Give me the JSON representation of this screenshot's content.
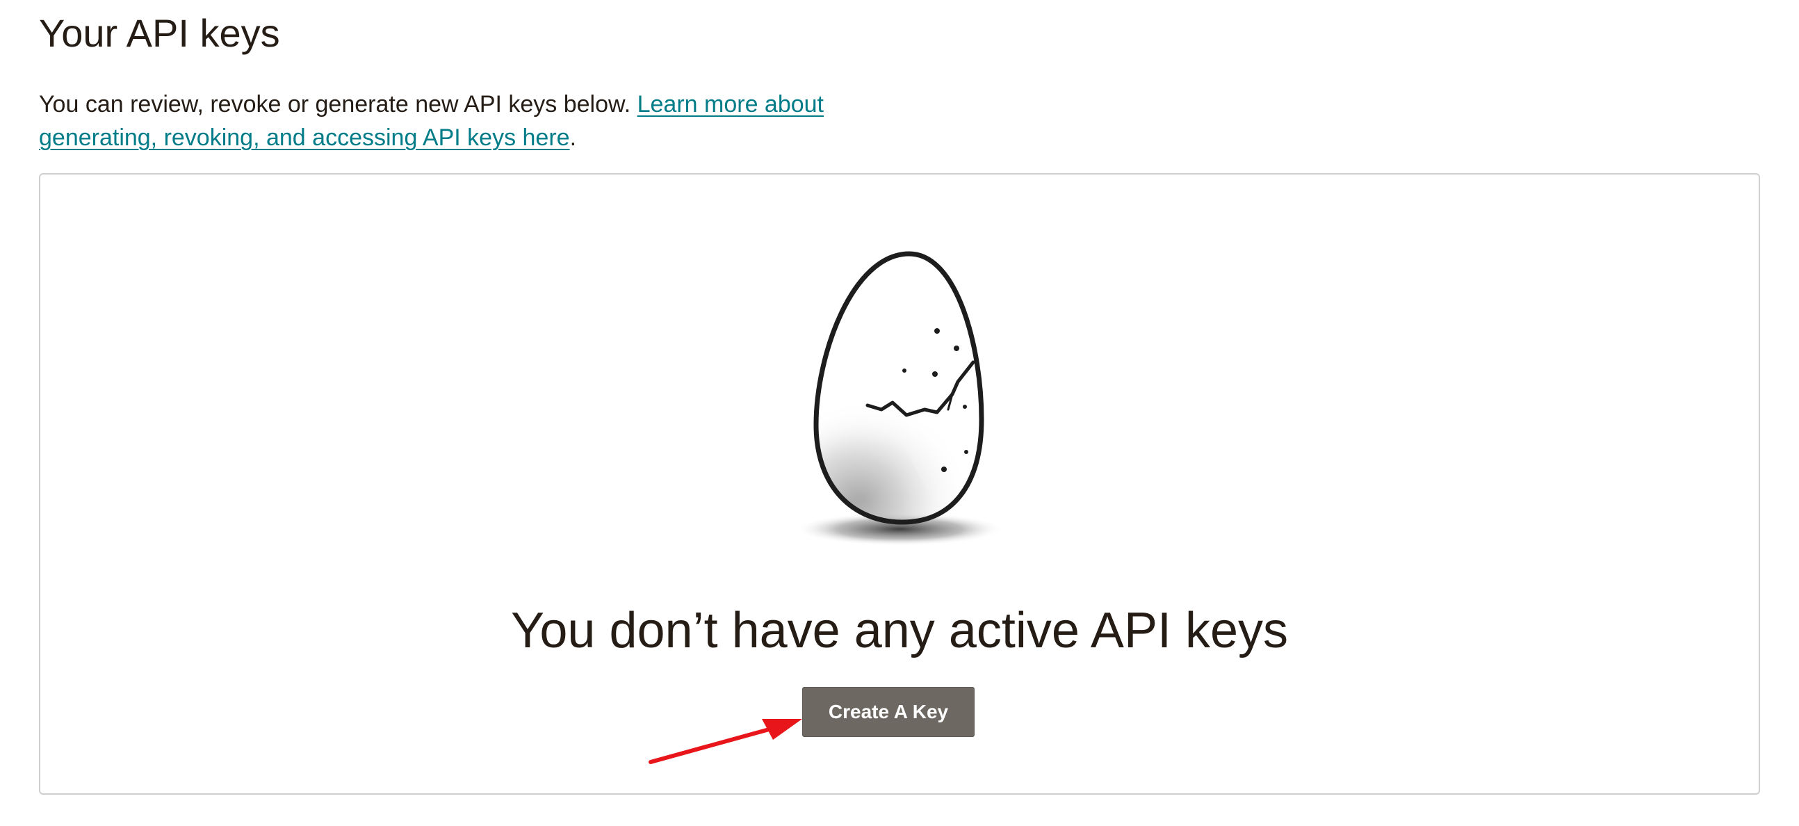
{
  "header": {
    "title": "Your API keys"
  },
  "intro": {
    "text": "You can review, revoke or generate new API keys below.",
    "link_text": "Learn more about generating, revoking, and accessing API keys here",
    "trailing": "."
  },
  "empty_state": {
    "illustration": "cracked-egg-icon",
    "title": "You don’t have any active API keys",
    "button_label": "Create A Key"
  },
  "annotation": {
    "arrow_color": "#e8161b"
  },
  "colors": {
    "text": "#241c15",
    "link": "#007c89",
    "button": "#6d6862",
    "border": "#cfcfcf"
  }
}
